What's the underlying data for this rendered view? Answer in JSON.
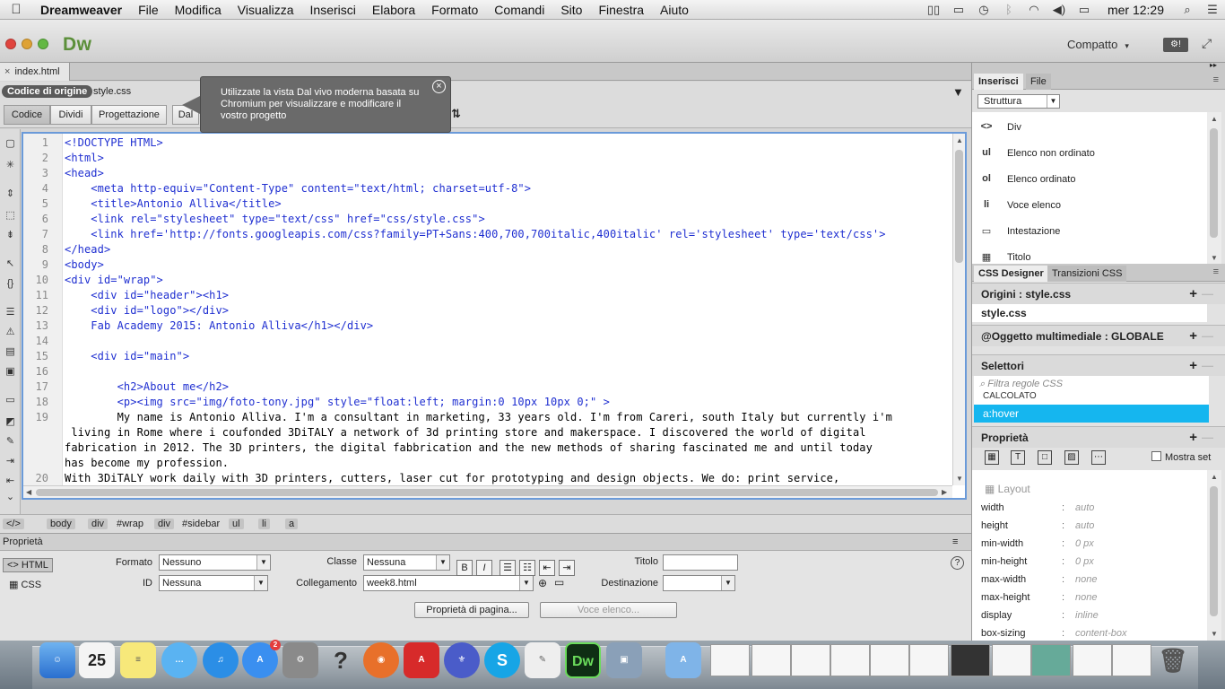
{
  "menubar": {
    "apple_glyph": "",
    "app": "Dreamweaver",
    "items": [
      "File",
      "Modifica",
      "Visualizza",
      "Inserisci",
      "Elabora",
      "Formato",
      "Comandi",
      "Sito",
      "Finestra",
      "Aiuto"
    ],
    "status_icons": [
      "sidebar-icon",
      "airplay-icon",
      "time-machine-icon",
      "bluetooth-icon",
      "wifi-icon",
      "volume-icon",
      "battery-icon"
    ],
    "clock": "mer 12:29",
    "search_icon": "spotlight-icon",
    "list_icon": "notification-icon"
  },
  "titlebar": {
    "logo": "Dw",
    "workspace": "Compatto",
    "workspace_caret": "▾"
  },
  "document": {
    "tab": "index.html",
    "tab_close": "×"
  },
  "related_files": {
    "source": "Codice di origine",
    "file": "style.css"
  },
  "views": {
    "code": "Codice",
    "split": "Dividi",
    "design": "Progettazione",
    "live": "Dal"
  },
  "tooltip": {
    "text": "Utilizzate la vista Dal vivo moderna basata su Chromium per visualizzare e modificare il vostro progetto",
    "close": "×"
  },
  "code": {
    "lines": [
      {
        "n": "1",
        "text": "<!DOCTYPE HTML>",
        "kind": "tag"
      },
      {
        "n": "2",
        "text": "<html>",
        "kind": "tag"
      },
      {
        "n": "3",
        "text": "<head>",
        "kind": "tag"
      },
      {
        "n": "4",
        "text": "    <meta http-equiv=\"Content-Type\" content=\"text/html; charset=utf-8\">",
        "kind": "tag"
      },
      {
        "n": "5",
        "text": "    <title>Antonio Alliva</title>",
        "kind": "tag"
      },
      {
        "n": "6",
        "text": "    <link rel=\"stylesheet\" type=\"text/css\" href=\"css/style.css\">",
        "kind": "tag"
      },
      {
        "n": "7",
        "text": "    <link href='http://fonts.googleapis.com/css?family=PT+Sans:400,700,700italic,400italic' rel='stylesheet' type='text/css'>",
        "kind": "tag"
      },
      {
        "n": "8",
        "text": "</head>",
        "kind": "tag"
      },
      {
        "n": "9",
        "text": "<body>",
        "kind": "tag"
      },
      {
        "n": "10",
        "text": "<div id=\"wrap\">",
        "kind": "tag"
      },
      {
        "n": "11",
        "text": "    <div id=\"header\"><h1>",
        "kind": "tag"
      },
      {
        "n": "12",
        "text": "    <div id=\"logo\"></div>",
        "kind": "tag"
      },
      {
        "n": "13",
        "text": "    Fab Academy 2015: Antonio Alliva</h1></div>",
        "kind": "mixed"
      },
      {
        "n": "14",
        "text": "",
        "kind": "tag"
      },
      {
        "n": "15",
        "text": "    <div id=\"main\">",
        "kind": "tag"
      },
      {
        "n": "16",
        "text": "",
        "kind": "tag"
      },
      {
        "n": "17",
        "text": "        <h2>About me</h2>",
        "kind": "mixed"
      },
      {
        "n": "18",
        "text": "        <p><img src=\"img/foto-tony.jpg\" style=\"float:left; margin:0 10px 10px 0;\" >",
        "kind": "tag"
      },
      {
        "n": "19",
        "text": "        My name is Antonio Alliva. I'm a consultant in marketing, 33 years old. I'm from Careri, south Italy but currently i'm",
        "kind": "txt"
      },
      {
        "n": "",
        "text": " living in Rome where i coufonded 3DiTALY a network of 3d printing store and makerspace. I discovered the world of digital",
        "kind": "txt"
      },
      {
        "n": "",
        "text": "fabrication in 2012. The 3D printers, the digital fabbrication and the new methods of sharing fascinated me and until today",
        "kind": "txt"
      },
      {
        "n": "",
        "text": "has become my profession.",
        "kind": "txt"
      },
      {
        "n": "20",
        "text": "With 3DiTALY work daily with 3D printers, cutters, laser cut for prototyping and design objects. We do: print service,",
        "kind": "txt"
      },
      {
        "n": "",
        "text": "assemble printers 3d, assistance, 3d modeling and informative workshop on digital fabrication.",
        "kind": "txt"
      }
    ]
  },
  "tag_selector": {
    "code_icon": "</>",
    "crumbs": [
      "body",
      "div",
      "#wrap",
      "div",
      "#sidebar",
      "ul",
      "li",
      "a"
    ]
  },
  "properties": {
    "header": "Proprietà",
    "html_btn": "<> HTML",
    "css_btn": "CSS",
    "formato_label": "Formato",
    "formato_value": "Nessuno",
    "classe_label": "Classe",
    "classe_value": "Nessuna",
    "id_label": "ID",
    "id_value": "Nessuna",
    "link_label": "Collegamento",
    "link_value": "week8.html",
    "titolo_label": "Titolo",
    "dest_label": "Destinazione",
    "bold": "B",
    "italic": "I",
    "page_props": "Proprietà di pagina...",
    "list_item": "Voce elenco...",
    "help": "?"
  },
  "right_panel": {
    "tabs": [
      "Inserisci",
      "File"
    ],
    "category": "Struttura",
    "insert_items": [
      {
        "icon": "<>",
        "label": "Div"
      },
      {
        "icon": "ul",
        "label": "Elenco non ordinato"
      },
      {
        "icon": "ol",
        "label": "Elenco ordinato"
      },
      {
        "icon": "li",
        "label": "Voce elenco"
      },
      {
        "icon": "▭",
        "label": "Intestazione"
      },
      {
        "icon": "▦",
        "label": "Titolo"
      }
    ],
    "css_tabs": [
      "CSS Designer",
      "Transizioni CSS"
    ],
    "origini_label": "Origini :  style.css",
    "source_file": "style.css",
    "media_label": "@Oggetto multimediale :  GLOBALE",
    "selettori_label": "Selettori",
    "filter_placeholder": "Filtra regole CSS",
    "calc_row": "CALCOLATO",
    "selected_selector": "a:hover",
    "proprieta_label": "Proprietà",
    "show_set": "Mostra set",
    "layout_head": "Layout",
    "props": [
      {
        "name": "width",
        "value": "auto"
      },
      {
        "name": "height",
        "value": "auto"
      },
      {
        "name": "min-width",
        "value": "0 px"
      },
      {
        "name": "min-height",
        "value": "0 px"
      },
      {
        "name": "max-width",
        "value": "none"
      },
      {
        "name": "max-height",
        "value": "none"
      },
      {
        "name": "display",
        "value": "inline"
      },
      {
        "name": "box-sizing",
        "value": "content-box"
      }
    ]
  },
  "dock": {
    "calendar_day": "25",
    "appstore_badge": "2",
    "acrobat_label": "A",
    "skype_label": "S",
    "dw_label": "Dw",
    "help_label": "?",
    "apps": [
      "finder-icon",
      "calendar-icon",
      "notes-icon",
      "messages-icon",
      "itunes-icon",
      "app-store-icon",
      "system-preferences-icon",
      "help-icon",
      "firefox-icon",
      "acrobat-icon",
      "filezilla-icon",
      "skype-icon",
      "textedit-icon",
      "dreamweaver-icon",
      "preview-icon",
      "applications-folder-icon",
      "trash-icon"
    ]
  }
}
